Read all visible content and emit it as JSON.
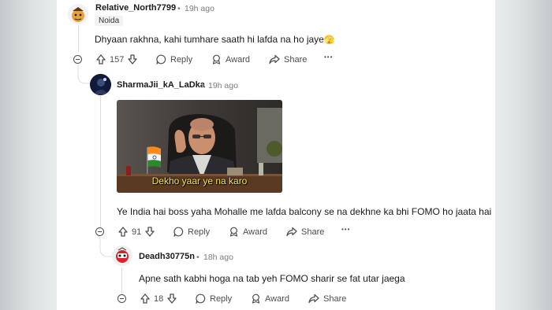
{
  "comments": [
    {
      "username": "Relative_North7799",
      "time": "19h ago",
      "flair": "Noida",
      "text": "Dhyaan rakhna, kahi tumhare saath hi lafda na ho jaye",
      "emoji": "🫣",
      "votes": "157",
      "reply": "Reply",
      "award": "Award",
      "share": "Share"
    },
    {
      "username": "SharmaJii_kA_LaDka",
      "time": "19h ago",
      "gif_caption": "Dekho yaar ye na karo",
      "text": "Ye India hai boss yaha Mohalle me lafda balcony se na dekhne ka bhi FOMO ho jaata hai",
      "votes": "91",
      "reply": "Reply",
      "award": "Award",
      "share": "Share"
    },
    {
      "username": "Deadh30775n",
      "time": "18h ago",
      "text": "Apne sath kabhi hoga na tab yeh FOMO sharir se fat utar jaega",
      "votes": "18",
      "reply": "Reply",
      "award": "Award",
      "share": "Share"
    }
  ],
  "separator": "•",
  "more": "•••"
}
